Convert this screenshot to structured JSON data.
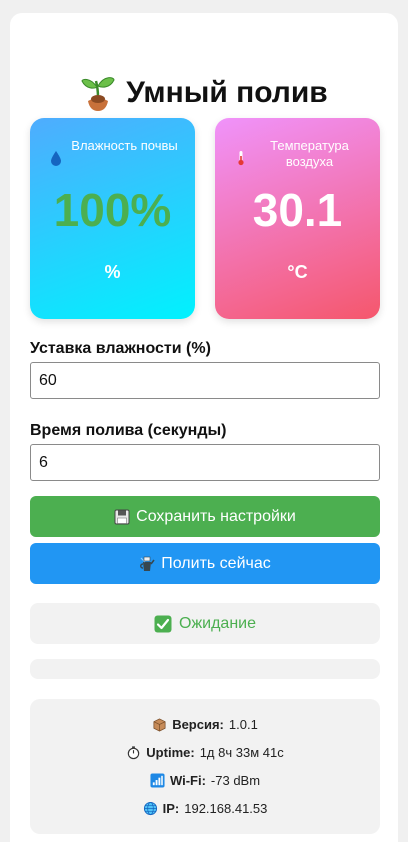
{
  "app": {
    "title": "Умный полив"
  },
  "sensors": {
    "humidity": {
      "label": "Влажность почвы",
      "value": "100%",
      "unit": "%",
      "icon": "droplet-icon",
      "value_color": "#4caf50"
    },
    "temperature": {
      "label": "Температура воздуха",
      "value": "30.1",
      "unit": "°C",
      "icon": "thermometer-icon"
    }
  },
  "settings": {
    "threshold_label": "Уставка влажности (%)",
    "threshold_value": "60",
    "duration_label": "Время полива (секунды)",
    "duration_value": "6"
  },
  "buttons": {
    "save_label": "Сохранить настройки",
    "save_icon": "floppy-disk-icon",
    "save_color": "#4caf50",
    "water_label": "Полить сейчас",
    "water_icon": "watering-can-icon",
    "water_color": "#2196f3"
  },
  "status": {
    "text": "Ожидание",
    "icon": "check-icon",
    "color": "#4caf50",
    "progress": 0
  },
  "info": {
    "version_label": "Версия:",
    "version_value": "1.0.1",
    "uptime_label": "Uptime:",
    "uptime_value": "1д 8ч 33м 41с",
    "wifi_label": "Wi-Fi:",
    "wifi_value": "-73 dBm",
    "ip_label": "IP:",
    "ip_value": "192.168.41.53"
  }
}
